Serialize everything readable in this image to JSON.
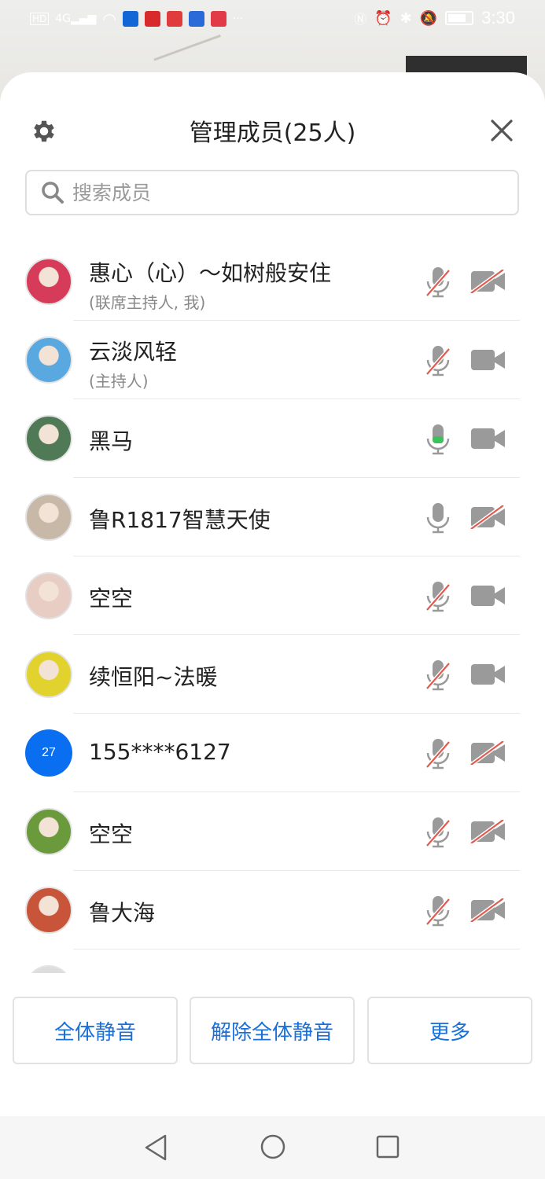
{
  "status_bar": {
    "left_icons": [
      "HD",
      "4G",
      "signal",
      "wifi",
      "app1",
      "mic-app",
      "huawei-app",
      "translate-app",
      "read-app",
      "more"
    ],
    "time": "3:30"
  },
  "header": {
    "title": "管理成员(25人)",
    "search_placeholder": "搜索成员"
  },
  "members": [
    {
      "name": "惠心（心）～如树般安住",
      "role": "(联席主持人, 我)",
      "mic": "muted",
      "cam": "off",
      "avatar_color": "#d63b5a"
    },
    {
      "name": "云淡风轻",
      "role": "(主持人)",
      "mic": "muted",
      "cam": "on",
      "avatar_color": "#5aa8e0"
    },
    {
      "name": "黑马",
      "role": "",
      "mic": "active",
      "cam": "on",
      "avatar_color": "#4f7a55"
    },
    {
      "name": "鲁R1817智慧天使",
      "role": "",
      "mic": "on",
      "cam": "off",
      "avatar_color": "#c8b8a8"
    },
    {
      "name": "空空",
      "role": "",
      "mic": "muted",
      "cam": "on",
      "avatar_color": "#e8cdc4"
    },
    {
      "name": "续恒阳~法暖",
      "role": "",
      "mic": "muted",
      "cam": "on",
      "avatar_color": "#e2d22e"
    },
    {
      "name": "155****6127",
      "role": "",
      "mic": "muted",
      "cam": "off",
      "avatar_text": "27",
      "avatar_color": "#0a6ef0"
    },
    {
      "name": "空空",
      "role": "",
      "mic": "muted",
      "cam": "off",
      "avatar_color": "#6a9a3c"
    },
    {
      "name": "鲁大海",
      "role": "",
      "mic": "muted",
      "cam": "off",
      "avatar_color": "#c8553a"
    }
  ],
  "buttons": {
    "mute_all": "全体静音",
    "unmute_all": "解除全体静音",
    "more": "更多"
  },
  "colors": {
    "accent": "#1a6fd8",
    "mute_slash": "#e05a4e",
    "icon_gray": "#9a9a9a",
    "mic_active": "#3cc25a"
  }
}
